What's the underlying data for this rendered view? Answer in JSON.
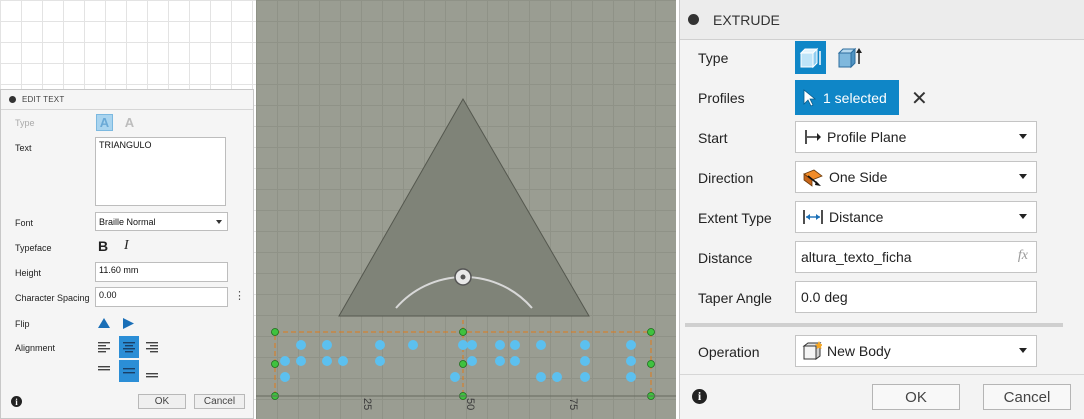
{
  "edit_text": {
    "title": "EDIT TEXT",
    "type_label": "Type",
    "text_label": "Text",
    "text_value": "TRIANGULO",
    "font_label": "Font",
    "font_value": "Braille Normal",
    "typeface_label": "Typeface",
    "bold_glyph": "B",
    "italic_glyph": "I",
    "height_label": "Height",
    "height_value": "11.60 mm",
    "spacing_label": "Character Spacing",
    "spacing_value": "0.00",
    "flip_label": "Flip",
    "alignment_label": "Alignment",
    "ok_label": "OK",
    "cancel_label": "Cancel"
  },
  "viewport": {
    "ruler_labels": [
      "25",
      "50",
      "75"
    ],
    "accent_dot_color": "#5cc0ef",
    "selection_color": "#e07b1a",
    "handle_color": "#3fc23f"
  },
  "extrude": {
    "title": "EXTRUDE",
    "type_label": "Type",
    "profiles_label": "Profiles",
    "profiles_value": "1 selected",
    "start_label": "Start",
    "start_value": "Profile Plane",
    "direction_label": "Direction",
    "direction_value": "One Side",
    "extent_label": "Extent Type",
    "extent_value": "Distance",
    "distance_label": "Distance",
    "distance_value": "altura_texto_ficha",
    "fx_label": "fx",
    "taper_label": "Taper Angle",
    "taper_value": "0.0 deg",
    "operation_label": "Operation",
    "operation_value": "New Body",
    "ok_label": "OK",
    "cancel_label": "Cancel",
    "accent_color": "#0f86c7"
  }
}
